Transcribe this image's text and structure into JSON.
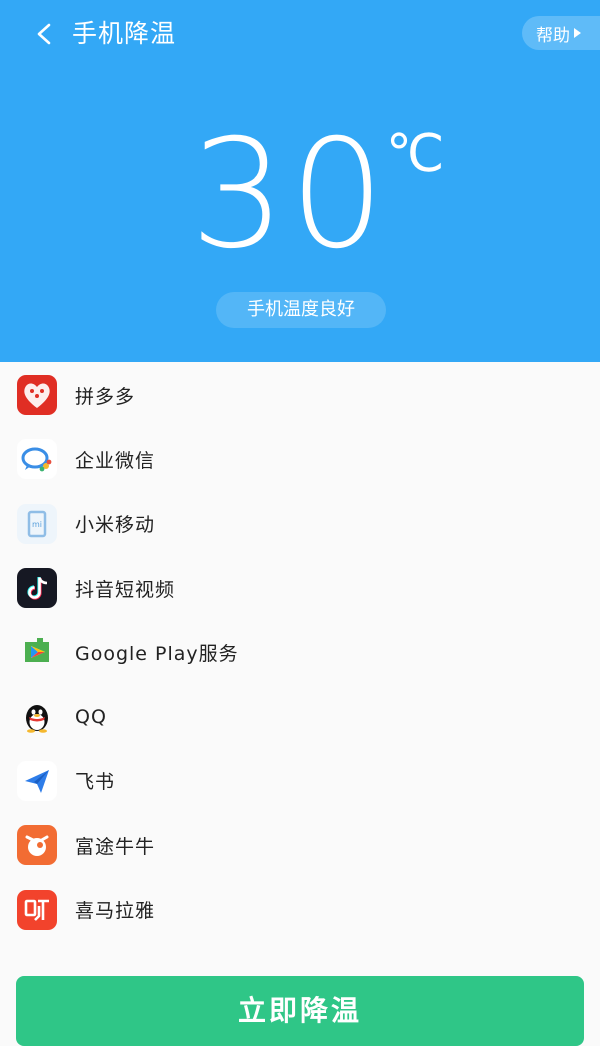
{
  "header": {
    "title": "手机降温",
    "help_label": "帮助",
    "background": "#33a8f6"
  },
  "temperature": {
    "value": "30",
    "unit": "℃",
    "status": "手机温度良好"
  },
  "apps": [
    {
      "name": "拼多多",
      "icon": "pinduoduo-icon"
    },
    {
      "name": "企业微信",
      "icon": "wecom-icon"
    },
    {
      "name": "小米移动",
      "icon": "mi-mobile-icon"
    },
    {
      "name": "抖音短视频",
      "icon": "douyin-icon"
    },
    {
      "name": "Google Play服务",
      "icon": "google-play-services-icon"
    },
    {
      "name": "QQ",
      "icon": "qq-icon"
    },
    {
      "name": "飞书",
      "icon": "feishu-icon"
    },
    {
      "name": "富途牛牛",
      "icon": "futu-icon"
    },
    {
      "name": "喜马拉雅",
      "icon": "ximalaya-icon"
    }
  ],
  "action": {
    "label": "立即降温",
    "color": "#2fc687"
  }
}
